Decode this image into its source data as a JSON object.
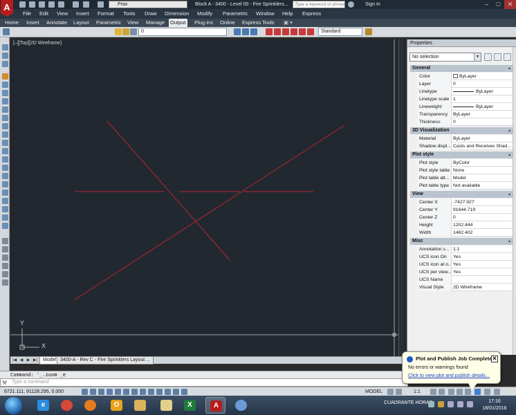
{
  "app": {
    "logo_letter": "A"
  },
  "titlebar": {
    "workspace": "Prax",
    "window_title": "Block A - 3400 - Level 00 - Fire Sprinklers...",
    "search_placeholder": "Type a keyword or phrase",
    "signin": "Sign In",
    "controls": [
      "–",
      "□",
      "✕"
    ]
  },
  "menubar": [
    "File",
    "Edit",
    "View",
    "Insert",
    "Format",
    "Tools",
    "Draw",
    "Dimension",
    "Modify",
    "Parametric",
    "Window",
    "Help",
    "Express"
  ],
  "ribbon_tabs": [
    "Home",
    "Insert",
    "Annotate",
    "Layout",
    "Parametric",
    "View",
    "Manage",
    "Output",
    "Plug-ins",
    "Online",
    "Express Tools"
  ],
  "ribbon_active_tab": "Output",
  "toolbar": {
    "layer_value": "0",
    "style_value": "Standard"
  },
  "viewport": {
    "label": "[–][Top][2D Wireframe]",
    "ucs_y": "Y",
    "ucs_x": "X"
  },
  "layout_tabs": {
    "model": "Model",
    "layout": "3400-A - Rev C - Fire Sprinklers Layout ..."
  },
  "command": {
    "history": "Command: '_.zoom _e",
    "placeholder": "Type a command"
  },
  "statusbar": {
    "coords": "6721.111, 91128.295, 0.000",
    "model_label": "MODEL",
    "scale": "1:1"
  },
  "properties": {
    "title": "Properties",
    "selection": "No selection",
    "sections": [
      {
        "name": "General",
        "rows": [
          {
            "k": "Color",
            "v": "ByLayer"
          },
          {
            "k": "Layer",
            "v": "0"
          },
          {
            "k": "Linetype",
            "v": "ByLayer"
          },
          {
            "k": "Linetype scale",
            "v": "1"
          },
          {
            "k": "Lineweight",
            "v": "ByLayer"
          },
          {
            "k": "Transparency",
            "v": "ByLayer"
          },
          {
            "k": "Thickness",
            "v": "0"
          }
        ]
      },
      {
        "name": "3D Visualization",
        "rows": [
          {
            "k": "Material",
            "v": "ByLayer"
          },
          {
            "k": "Shadow displ...",
            "v": "Casts and Receives Shad..."
          }
        ]
      },
      {
        "name": "Plot style",
        "rows": [
          {
            "k": "Plot style",
            "v": "ByColor"
          },
          {
            "k": "Plot style table",
            "v": "None"
          },
          {
            "k": "Plot table att...",
            "v": "Model"
          },
          {
            "k": "Plot table type",
            "v": "Not available"
          }
        ]
      },
      {
        "name": "View",
        "rows": [
          {
            "k": "Center X",
            "v": "-7427.927"
          },
          {
            "k": "Center Y",
            "v": "91644.719"
          },
          {
            "k": "Center Z",
            "v": "0"
          },
          {
            "k": "Height",
            "v": "1202.444"
          },
          {
            "k": "Width",
            "v": "1482.402"
          }
        ]
      },
      {
        "name": "Misc",
        "rows": [
          {
            "k": "Annotation s...",
            "v": "1:1"
          },
          {
            "k": "UCS icon On",
            "v": "Yes"
          },
          {
            "k": "UCS icon at o...",
            "v": "Yes"
          },
          {
            "k": "UCS per view...",
            "v": "Yes"
          },
          {
            "k": "UCS Name",
            "v": ""
          },
          {
            "k": "Visual Style",
            "v": "2D Wireframe"
          }
        ]
      }
    ]
  },
  "notification": {
    "title": "Plot and Publish Job Complete",
    "message": "No errors or warnings found",
    "link": "Click to view plot and publish details...",
    "close": "✕"
  },
  "taskbar": {
    "running_task": "CUADRANTE HORAS",
    "time": "17:16",
    "date": "18/01/2016",
    "apps": [
      "internet-explorer",
      "chrome",
      "firefox",
      "outlook",
      "file-explorer",
      "notepad",
      "excel",
      "autocad",
      "paint"
    ]
  },
  "colors": {
    "canvas_bg": "#212830",
    "drawing_line": "#b8262b",
    "accent": "#b51d1d"
  }
}
